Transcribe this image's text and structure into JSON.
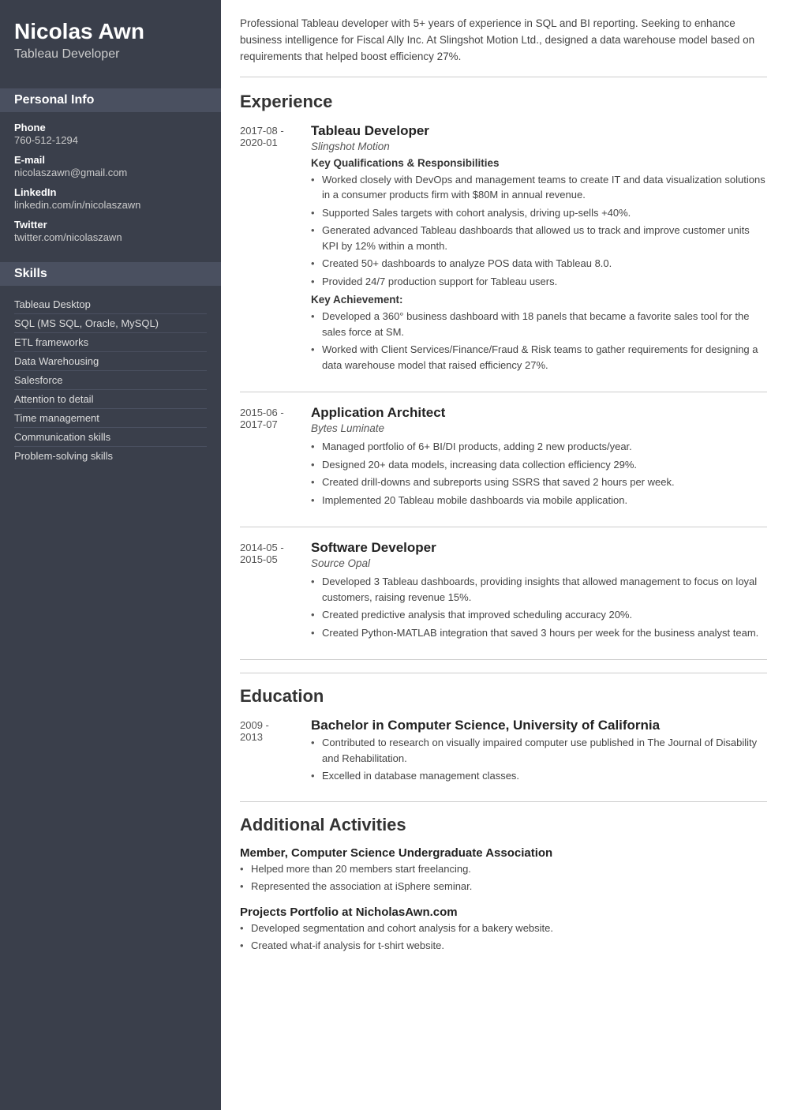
{
  "sidebar": {
    "name": "Nicolas Awn",
    "job_title": "Tableau Developer",
    "sections": {
      "personal_info": {
        "title": "Personal Info",
        "fields": [
          {
            "label": "Phone",
            "value": "760-512-1294"
          },
          {
            "label": "E-mail",
            "value": "nicolaszawn@gmail.com"
          },
          {
            "label": "LinkedIn",
            "value": "linkedin.com/in/nicolaszawn"
          },
          {
            "label": "Twitter",
            "value": "twitter.com/nicolaszawn"
          }
        ]
      },
      "skills": {
        "title": "Skills",
        "items": [
          "Tableau Desktop",
          "SQL (MS SQL, Oracle, MySQL)",
          "ETL frameworks",
          "Data Warehousing",
          "Salesforce",
          "Attention to detail",
          "Time management",
          "Communication skills",
          "Problem-solving skills"
        ]
      }
    }
  },
  "main": {
    "summary": "Professional Tableau developer with 5+ years of experience in SQL and BI reporting. Seeking to enhance business intelligence for Fiscal Ally Inc. At Slingshot Motion Ltd., designed a data warehouse model based on requirements that helped boost efficiency 27%.",
    "experience": {
      "section_title": "Experience",
      "entries": [
        {
          "date": "2017-08 -\n2020-01",
          "title": "Tableau Developer",
          "company": "Slingshot Motion",
          "subsections": [
            {
              "subtitle": "Key Qualifications & Responsibilities",
              "bullets": [
                "Worked closely with DevOps and management teams to create IT and data visualization solutions in a consumer products firm with $80M in annual revenue.",
                "Supported Sales targets with cohort analysis, driving up-sells +40%.",
                "Generated advanced Tableau dashboards that allowed us to track and improve customer units KPI by 12% within a month.",
                "Created 50+ dashboards to analyze POS data with Tableau 8.0.",
                "Provided 24/7 production support for Tableau users."
              ]
            },
            {
              "subtitle": "Key Achievement:",
              "bullets": [
                "Developed a 360° business dashboard with 18 panels that became a favorite sales tool for the sales force at SM.",
                "Worked with Client Services/Finance/Fraud & Risk teams to gather requirements for designing a data warehouse model that raised efficiency 27%."
              ]
            }
          ]
        },
        {
          "date": "2015-06 -\n2017-07",
          "title": "Application Architect",
          "company": "Bytes Luminate",
          "subsections": [
            {
              "subtitle": "",
              "bullets": [
                "Managed portfolio of 6+ BI/DI products, adding 2 new products/year.",
                "Designed 20+ data models, increasing data collection efficiency 29%.",
                "Created drill-downs and subreports using SSRS that saved 2 hours per week.",
                "Implemented 20 Tableau mobile dashboards via mobile application."
              ]
            }
          ]
        },
        {
          "date": "2014-05 -\n2015-05",
          "title": "Software Developer",
          "company": "Source Opal",
          "subsections": [
            {
              "subtitle": "",
              "bullets": [
                "Developed 3 Tableau dashboards, providing insights that allowed management to focus on loyal customers, raising revenue 15%.",
                "Created predictive analysis that improved scheduling accuracy 20%.",
                "Created Python-MATLAB integration that saved 3 hours per week for the business analyst team."
              ]
            }
          ]
        }
      ]
    },
    "education": {
      "section_title": "Education",
      "entries": [
        {
          "date": "2009 -\n2013",
          "title": "Bachelor in Computer Science, University of California",
          "bullets": [
            "Contributed to research on visually impaired computer use published in The Journal of Disability and Rehabilitation.",
            "Excelled in database management classes."
          ]
        }
      ]
    },
    "additional_activities": {
      "section_title": "Additional Activities",
      "entries": [
        {
          "title": "Member, Computer Science Undergraduate Association",
          "bullets": [
            "Helped more than 20 members start freelancing.",
            "Represented the association at iSphere seminar."
          ]
        },
        {
          "title": "Projects Portfolio at NicholasAwn.com",
          "bullets": [
            "Developed segmentation and cohort analysis for a bakery website.",
            "Created what-if analysis for t-shirt website."
          ]
        }
      ]
    }
  }
}
